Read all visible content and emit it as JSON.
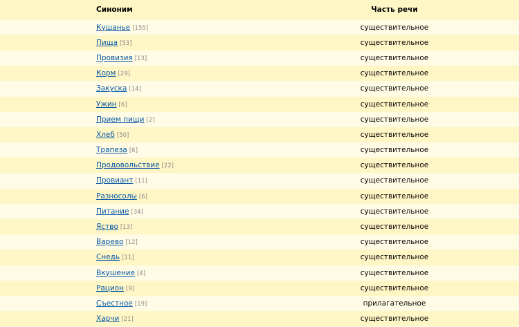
{
  "header": {
    "synonym_label": "Синоним",
    "pos_label": "Часть речи"
  },
  "rows": [
    {
      "word": "Кушанье",
      "count": "[155]",
      "pos": "существительное"
    },
    {
      "word": "Пища",
      "count": "[53]",
      "pos": "существительное"
    },
    {
      "word": "Провизия",
      "count": "[13]",
      "pos": "существительное"
    },
    {
      "word": "Корм",
      "count": "[29]",
      "pos": "существительное"
    },
    {
      "word": "Закуска",
      "count": "[14]",
      "pos": "существительное"
    },
    {
      "word": "Ужин",
      "count": "[6]",
      "pos": "существительное"
    },
    {
      "word": "Прием пищи",
      "count": "[2]",
      "pos": "существительное"
    },
    {
      "word": "Хлеб",
      "count": "[50]",
      "pos": "существительное"
    },
    {
      "word": "Трапеза",
      "count": "[6]",
      "pos": "существительное"
    },
    {
      "word": "Продовольствие",
      "count": "[22]",
      "pos": "существительное"
    },
    {
      "word": "Провиант",
      "count": "[11]",
      "pos": "существительное"
    },
    {
      "word": "Разносолы",
      "count": "[6]",
      "pos": "существительное"
    },
    {
      "word": "Питание",
      "count": "[34]",
      "pos": "существительное"
    },
    {
      "word": "Яство",
      "count": "[13]",
      "pos": "существительное"
    },
    {
      "word": "Варево",
      "count": "[12]",
      "pos": "существительное"
    },
    {
      "word": "Снедь",
      "count": "[11]",
      "pos": "существительное"
    },
    {
      "word": "Вкушение",
      "count": "[4]",
      "pos": "существительное"
    },
    {
      "word": "Рацион",
      "count": "[9]",
      "pos": "существительное"
    },
    {
      "word": "Съестное",
      "count": "[19]",
      "pos": "прилагательное"
    },
    {
      "word": "Харчи",
      "count": "[21]",
      "pos": "существительное"
    }
  ],
  "colors": {
    "row_light": "#fffbe5",
    "row_dark": "#fff6c6",
    "link": "#0658a5",
    "count": "#8a8a8a"
  }
}
